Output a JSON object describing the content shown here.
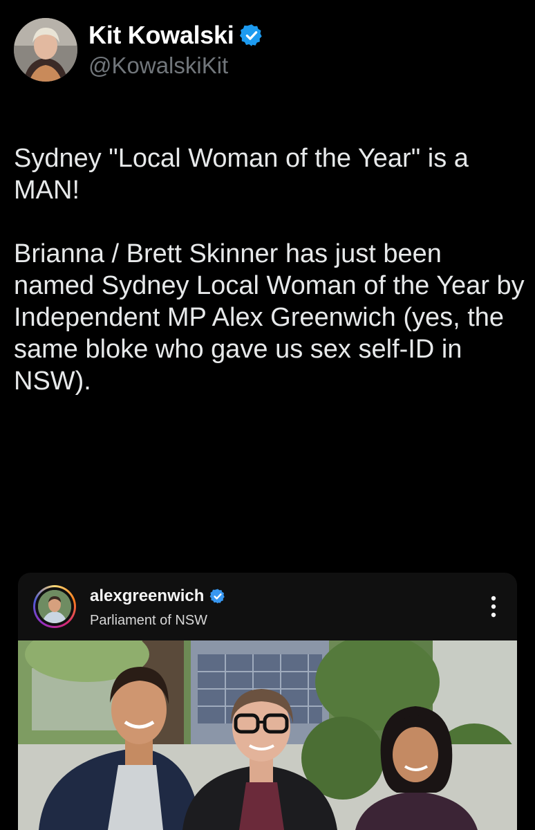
{
  "tweet": {
    "display_name": "Kit Kowalski",
    "handle": "@KowalskiKit",
    "verified_icon": "verified-badge-icon",
    "paragraphs": [
      "Sydney \"Local Woman of the Year\" is a MAN!",
      "Brianna / Brett Skinner has just been named Sydney Local Woman of the Year by Independent MP Alex Greenwich (yes, the same bloke who gave us sex self-ID in NSW)."
    ]
  },
  "embed": {
    "username": "alexgreenwich",
    "location": "Parliament of NSW",
    "more_icon": "more-options-icon"
  },
  "colors": {
    "background": "#000000",
    "text": "#e7e9ea",
    "handle": "#71767b",
    "verified": "#1d9bf0",
    "embed_bg": "#101010"
  }
}
